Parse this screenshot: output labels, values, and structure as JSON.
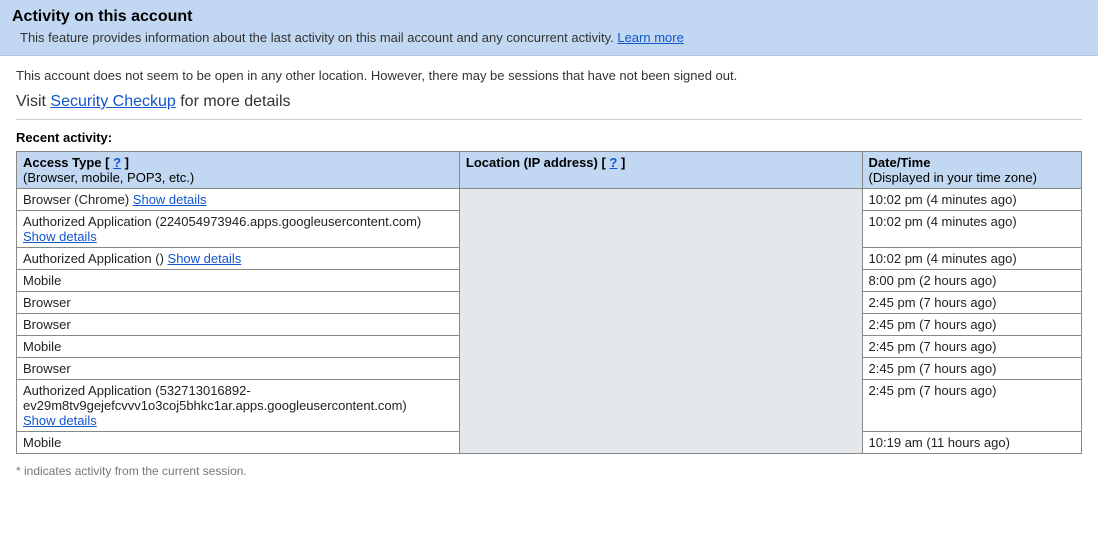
{
  "header": {
    "title": "Activity on this account",
    "description": "This feature provides information about the last activity on this mail account and any concurrent activity. ",
    "learn_more": "Learn more"
  },
  "status": "This account does not seem to be open in any other location. However, there may be sessions that have not been signed out.",
  "visit_prefix": "Visit ",
  "visit_link": "Security Checkup",
  "visit_suffix": " for more details",
  "recent_title": "Recent activity:",
  "table": {
    "headers": {
      "access_type": "Access Type [ ",
      "access_type_q": "?",
      "access_type_close": " ]",
      "access_type_sub": "(Browser, mobile, POP3, etc.)",
      "location": "Location (IP address) [ ",
      "location_q": "?",
      "location_close": " ]",
      "datetime": "Date/Time",
      "datetime_sub": "(Displayed in your time zone)"
    },
    "rows": [
      {
        "access": "Browser (Chrome) ",
        "details": "Show details",
        "datetime": "10:02 pm (4 minutes ago)"
      },
      {
        "access": "Authorized Application (224054973946.apps.googleusercontent.com)",
        "details_newline": "Show details",
        "datetime": "10:02 pm (4 minutes ago)"
      },
      {
        "access": "Authorized Application () ",
        "details": "Show details",
        "datetime": "10:02 pm (4 minutes ago)"
      },
      {
        "access": "Mobile",
        "datetime": "8:00 pm (2 hours ago)"
      },
      {
        "access": "Browser",
        "datetime": "2:45 pm (7 hours ago)"
      },
      {
        "access": "Browser",
        "datetime": "2:45 pm (7 hours ago)"
      },
      {
        "access": "Mobile",
        "datetime": "2:45 pm (7 hours ago)"
      },
      {
        "access": "Browser",
        "datetime": "2:45 pm (7 hours ago)"
      },
      {
        "access": "Authorized Application (532713016892-ev29m8tv9gejefcvvv1o3coj5bhkc1ar.apps.googleusercontent.com)",
        "details_newline": "Show details",
        "datetime": "2:45 pm (7 hours ago)"
      },
      {
        "access": "Mobile",
        "datetime": "10:19 am (11 hours ago)"
      }
    ]
  },
  "footer_note": "* indicates activity from the current session."
}
